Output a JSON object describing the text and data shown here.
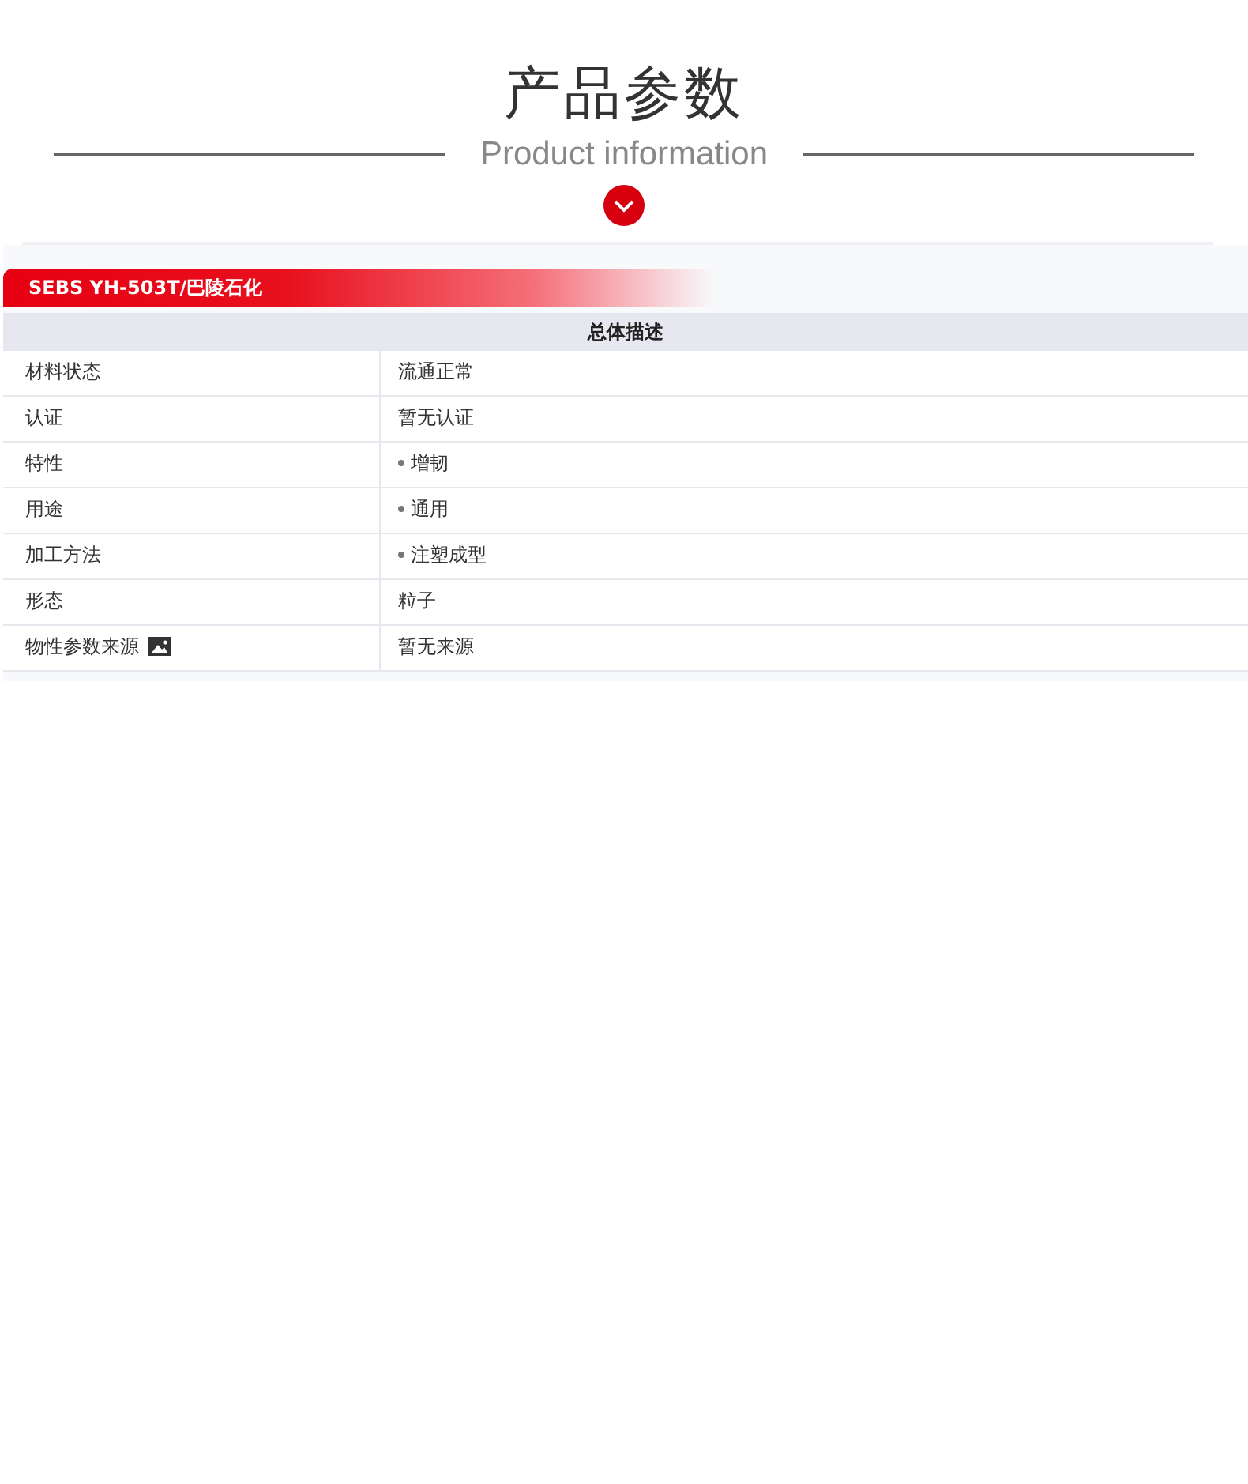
{
  "heading": {
    "title": "产品参数",
    "subtitle": "Product information"
  },
  "banner": {
    "title": "SEBS YH-503T/巴陵石化"
  },
  "table": {
    "header": "总体描述",
    "rows": [
      {
        "label": "材料状态",
        "value": "流通正常",
        "bullet": false,
        "icon": false
      },
      {
        "label": "认证",
        "value": "暂无认证",
        "bullet": false,
        "icon": false
      },
      {
        "label": "特性",
        "value": "增韧",
        "bullet": true,
        "icon": false
      },
      {
        "label": "用途",
        "value": "通用",
        "bullet": true,
        "icon": false
      },
      {
        "label": "加工方法",
        "value": "注塑成型",
        "bullet": true,
        "icon": false
      },
      {
        "label": "形态",
        "value": "粒子",
        "bullet": false,
        "icon": false
      },
      {
        "label": "物性参数来源",
        "value": "暂无来源",
        "bullet": false,
        "icon": true
      }
    ]
  }
}
